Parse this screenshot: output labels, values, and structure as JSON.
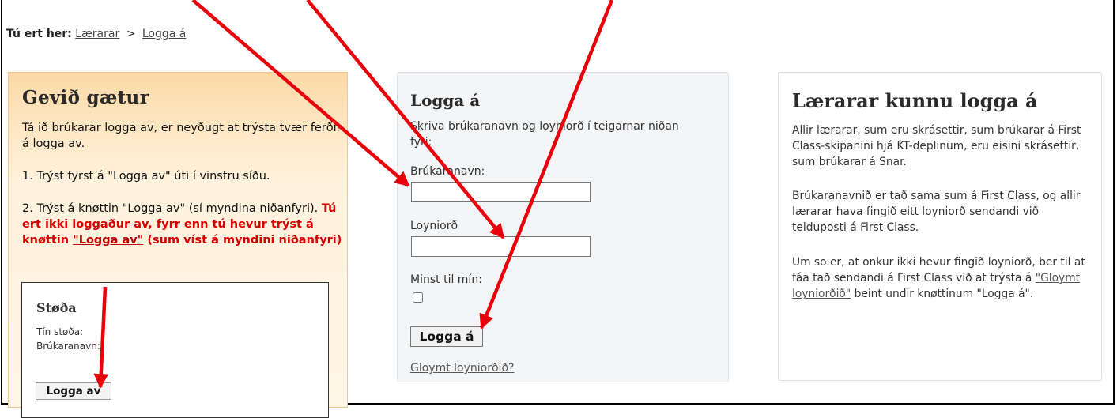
{
  "breadcrumb": {
    "prefix": "Tú ert her:",
    "item_1": "Lærarar",
    "separator": ">",
    "item_2": "Logga á"
  },
  "notice_panel": {
    "title": "Gevið gætur",
    "intro": "Tá ið brúkarar logga av, er neyðugt at trýsta tvær ferðir á logga av.",
    "step_1": "1. Trýst fyrst á \"Logga av\" úti í vinstru síðu.",
    "step_2_start": "2. Trýst á knøttin \"Logga av\" (sí myndina niðanfyri).",
    "step_2_warning_start": "Tú ert ikki loggaður av, fyrr enn tú hevur trýst á knøttin",
    "step_2_warning_link": "\"Logga av\"",
    "step_2_warning_end": "(sum víst á myndini niðanfyri)",
    "status_box": {
      "title": "Støða",
      "status_label": "Tín støða:",
      "username_label": "Brúkaranavn:",
      "logout_button": "Logga av"
    }
  },
  "login_form": {
    "title": "Logga á",
    "instructions": "Skriva brúkaranavn og loyniorð í teigarnar niðan fyri:",
    "username_label": "Brúkaranavn:",
    "username_value": "",
    "password_label": "Loyniorð",
    "password_value": "",
    "remember_label": "Minst til mín:",
    "remember_checked": false,
    "submit_label": "Logga á",
    "forgot_link": "Gloymt loyniorðið?"
  },
  "info_panel": {
    "title": "Lærarar kunnu logga á",
    "paragraph_1": "Allir lærarar, sum eru skrásettir, sum brúkarar á First Class-skipanini hjá KT-deplinum, eru eisini skrásettir, sum brúkarar á Snar.",
    "paragraph_2": "Brúkaranavnið er tað sama sum á First Class, og allir lærarar hava fingið eitt loyniorð sendandi við telduposti á First Class.",
    "paragraph_3_start": "Um so er, at onkur ikki hevur fingið loyniorð, ber til at fáa tað sendandi á First Class við at trýsta á",
    "paragraph_3_link": "\"Gloymt loyniorðið\"",
    "paragraph_3_end": "beint undir knøttinum \"Logga á\"."
  },
  "colors": {
    "arrow": "#e8000b",
    "warning_text": "#d60000",
    "panel_orange": "#fcd9a6"
  }
}
